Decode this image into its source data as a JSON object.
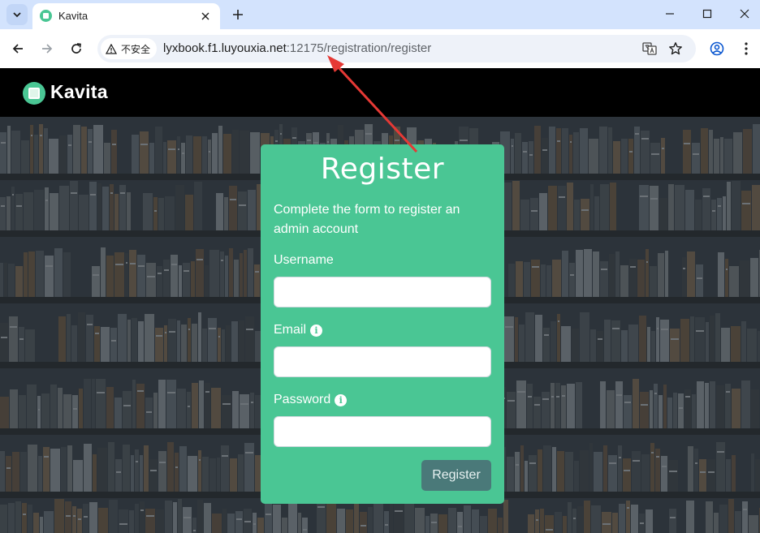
{
  "browser": {
    "tab": {
      "title": "Kavita"
    },
    "security_label": "不安全",
    "url": {
      "host": "lyxbook.f1.luyouxia.net",
      "rest": ":12175/registration/register"
    }
  },
  "header": {
    "brand": "Kavita"
  },
  "form": {
    "title": "Register",
    "description": "Complete the form to register an admin account",
    "username_label": "Username",
    "username_value": "",
    "email_label": "Email",
    "email_value": "",
    "password_label": "Password",
    "password_value": "",
    "info_glyph": "i",
    "submit_label": "Register"
  },
  "colors": {
    "accent": "#4ac694",
    "button": "#4a7979",
    "annotation_arrow": "#e53935"
  },
  "icons": [
    "chevron-down-icon",
    "kavita-favicon-icon",
    "close-icon",
    "plus-icon",
    "minimize-icon",
    "maximize-icon",
    "back-arrow-icon",
    "forward-arrow-icon",
    "reload-icon",
    "warning-icon",
    "translate-icon",
    "star-icon",
    "profile-icon",
    "kebab-menu-icon",
    "kavita-logo-icon",
    "info-icon"
  ]
}
